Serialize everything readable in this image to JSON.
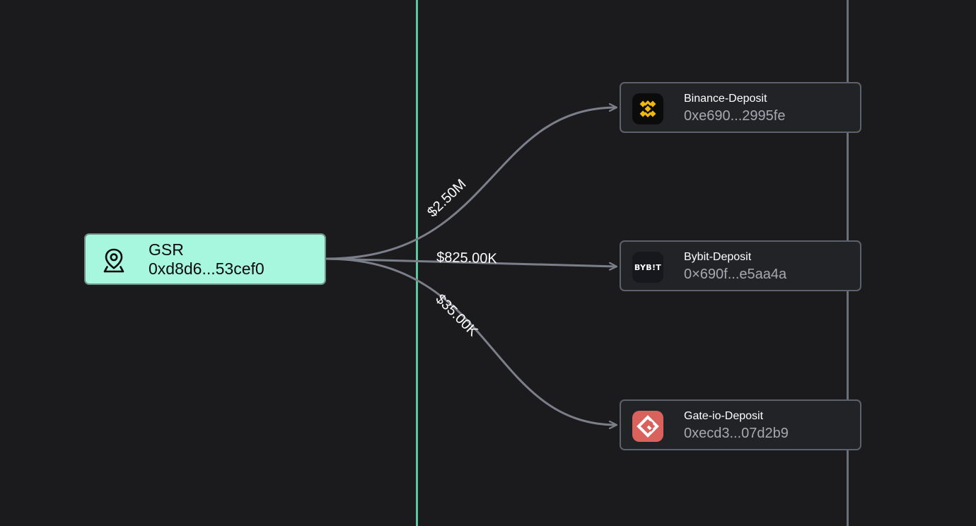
{
  "colors": {
    "background": "#1b1b1e",
    "source_fill": "#a6f7dd",
    "target_fill": "#222327",
    "edge": "#7b7f8a",
    "green_guide": "#5fc6a0",
    "gray_guide": "#6b6f78",
    "binance": "#f0b90b",
    "gate": "#d9625c"
  },
  "source": {
    "icon": "location-pin-icon",
    "name": "GSR",
    "address": "0xd8d6...53cef0"
  },
  "targets": [
    {
      "icon": "binance-logo-icon",
      "name": "Binance-Deposit",
      "address": "0xe690...2995fe"
    },
    {
      "icon": "bybit-logo-icon",
      "logo_text": "BYB!T",
      "name": "Bybit-Deposit",
      "address": "0×690f...e5aa4a"
    },
    {
      "icon": "gateio-logo-icon",
      "name": "Gate-io-Deposit",
      "address": "0xecd3...07d2b9"
    }
  ],
  "edges": [
    {
      "label": "$2.50M",
      "to": 0
    },
    {
      "label": "$825.00K",
      "to": 1
    },
    {
      "label": "$35.00K",
      "to": 2
    }
  ]
}
